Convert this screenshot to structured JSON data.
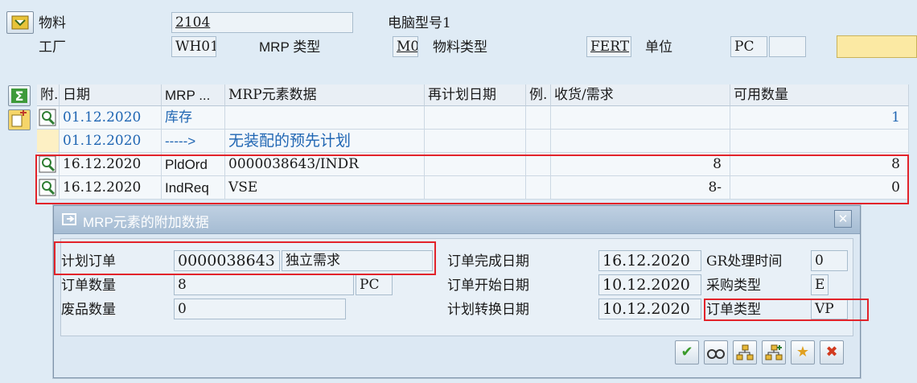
{
  "header": {
    "material_label": "物料",
    "material_value": "2104",
    "computer_model": "电脑型号1",
    "plant_label": "工厂",
    "plant_value": "WH01",
    "mrp_type_label": "MRP 类型",
    "mrp_type_value": "M0",
    "material_type_label": "物料类型",
    "material_type_value": "FERT",
    "unit_label": "单位",
    "unit_value": "PC"
  },
  "grid": {
    "columns": [
      "附.",
      "日期",
      "MRP ...",
      "MRP元素数据",
      "再计划日期",
      "例.",
      "收货/需求",
      "可用数量"
    ],
    "rows": [
      {
        "date": "01.12.2020",
        "mrp": "库存",
        "data": "",
        "qty": "",
        "avail": "1"
      },
      {
        "date": "01.12.2020",
        "mrp": "----->",
        "data": "无装配的预先计划",
        "qty": "",
        "avail": ""
      },
      {
        "date": "16.12.2020",
        "mrp": "PldOrd",
        "data": "0000038643/INDR",
        "qty": "8",
        "avail": "8"
      },
      {
        "date": "16.12.2020",
        "mrp": "IndReq",
        "data": "VSE",
        "qty": "8-",
        "avail": "0"
      }
    ]
  },
  "dialog": {
    "title": "MRP元素的附加数据",
    "planned_order_label": "计划订单",
    "planned_order_value": "0000038643",
    "planned_order_text": "独立需求",
    "order_qty_label": "订单数量",
    "order_qty_value": "8",
    "order_qty_unit": "PC",
    "scrap_qty_label": "废品数量",
    "scrap_qty_value": "0",
    "finish_date_label": "订单完成日期",
    "finish_date_value": "16.12.2020",
    "start_date_label": "订单开始日期",
    "start_date_value": "10.12.2020",
    "convert_date_label": "计划转换日期",
    "convert_date_value": "10.12.2020",
    "gr_time_label": "GR处理时间",
    "gr_time_value": "0",
    "procurement_label": "采购类型",
    "procurement_value": "E",
    "order_type_label": "订单类型",
    "order_type_value": "VP"
  },
  "colors": {
    "annotation_red": "#e2232a",
    "link_blue": "#2066b3",
    "confirm_green": "#3a9a2a",
    "cancel_red": "#d23a1f"
  }
}
